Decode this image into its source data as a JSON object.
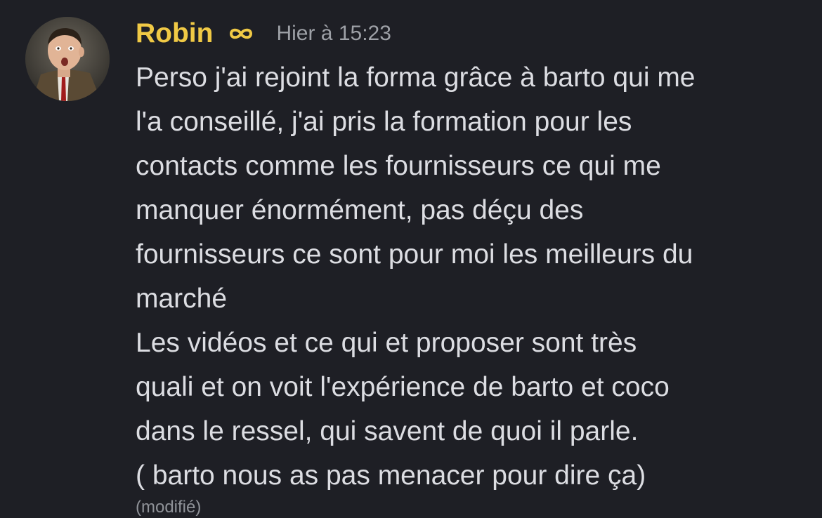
{
  "message": {
    "author": "Robin",
    "badge_icon": "infinity-icon",
    "timestamp": "Hier à 15:23",
    "lines": [
      "Perso j'ai rejoint la forma grâce à barto qui me",
      "l'a conseillé, j'ai pris la formation pour les",
      "contacts comme les fournisseurs ce qui me",
      "manquer énormément, pas déçu des",
      "fournisseurs ce sont pour moi les meilleurs du",
      "marché",
      "Les vidéos et ce qui et proposer sont très",
      "quali et on voit l'expérience de barto et coco",
      "dans le ressel, qui savent de quoi il parle.",
      "( barto nous as pas menacer pour dire ça)"
    ],
    "edited_label": "(modifié)"
  },
  "colors": {
    "background": "#1e1f25",
    "username": "#f0c945",
    "text": "#dcdde2",
    "timestamp": "#9ea1a7"
  }
}
